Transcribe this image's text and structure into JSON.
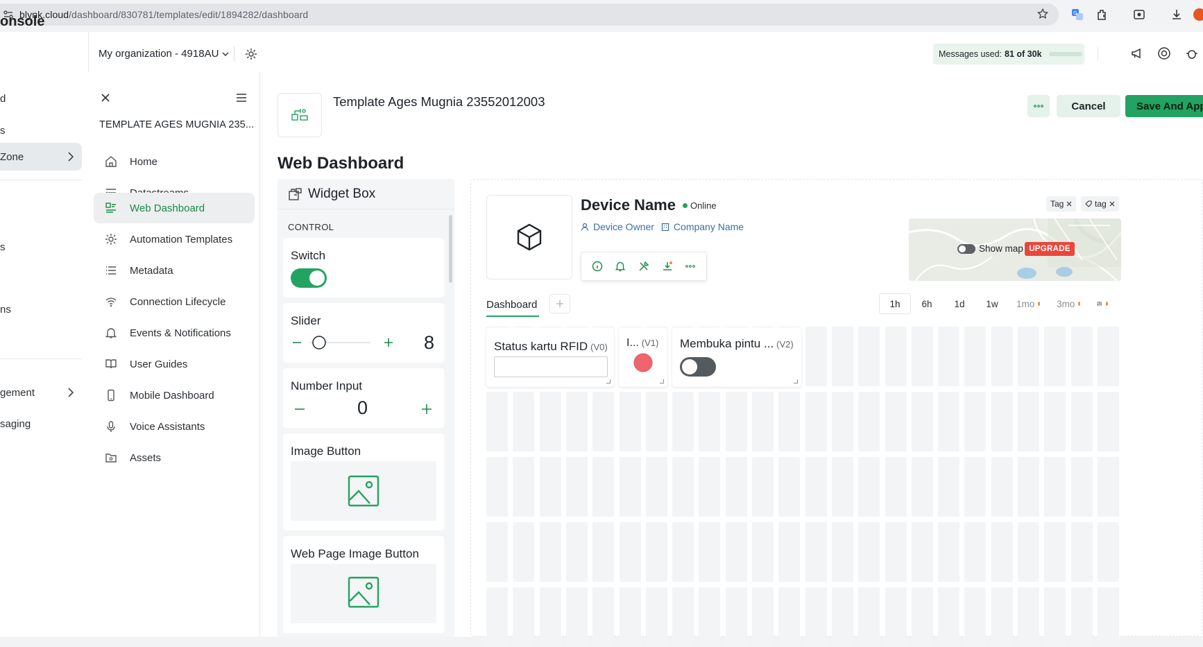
{
  "browser": {
    "url_host": "blynk.cloud",
    "url_path": "/dashboard/830781/templates/edit/1894282/dashboard"
  },
  "topbar": {
    "console_title": "onsole",
    "org_name": "My organization - 4918AU",
    "messages_label": "Messages used:",
    "messages_value": "81 of 30k"
  },
  "main_nav": {
    "items": [
      {
        "label": "d"
      },
      {
        "label": "s"
      },
      {
        "label": "Zone"
      },
      {
        "label": "s"
      },
      {
        "label": "ns"
      },
      {
        "label": "gement"
      },
      {
        "label": "saging"
      }
    ]
  },
  "template_sidebar": {
    "name": "TEMPLATE AGES MUGNIA 235...",
    "items": [
      {
        "label": "Home",
        "icon": "home-icon"
      },
      {
        "label": "Datastreams",
        "icon": "datastreams-icon"
      },
      {
        "label": "Web Dashboard",
        "icon": "web-dashboard-icon"
      },
      {
        "label": "Automation Templates",
        "icon": "automation-icon"
      },
      {
        "label": "Metadata",
        "icon": "metadata-icon"
      },
      {
        "label": "Connection Lifecycle",
        "icon": "wifi-icon"
      },
      {
        "label": "Events & Notifications",
        "icon": "bell-icon"
      },
      {
        "label": "User Guides",
        "icon": "book-icon"
      },
      {
        "label": "Mobile Dashboard",
        "icon": "mobile-icon"
      },
      {
        "label": "Voice Assistants",
        "icon": "microphone-icon"
      },
      {
        "label": "Assets",
        "icon": "folder-icon"
      }
    ]
  },
  "header": {
    "template_title": "Template Ages Mugnia 23552012003",
    "cancel_label": "Cancel",
    "save_label": "Save And Appl",
    "page_title": "Web Dashboard"
  },
  "widget_box": {
    "title": "Widget Box",
    "section": "CONTROL",
    "widgets": {
      "switch": "Switch",
      "slider": "Slider",
      "slider_value": "8",
      "number_input": "Number Input",
      "number_value": "0",
      "image_button": "Image Button",
      "web_image_button": "Web Page Image Button"
    }
  },
  "device": {
    "name": "Device Name",
    "status": "Online",
    "owner": "Device Owner",
    "company": "Company Name",
    "tags": [
      "Tag",
      "tag"
    ],
    "map_label": "Show map",
    "upgrade_label": "UPGRADE"
  },
  "dashboard": {
    "tab_label": "Dashboard",
    "ranges": [
      "1h",
      "6h",
      "1d",
      "1w",
      "1mo",
      "3mo"
    ],
    "active_range": "1h",
    "widgets": [
      {
        "title": "Status kartu RFID",
        "pin": "(V0)"
      },
      {
        "title": "I...",
        "pin": "(V1)"
      },
      {
        "title": "Membuka pintu ...",
        "pin": "(V2)"
      }
    ]
  },
  "colors": {
    "accent": "#23a362",
    "led_red": "#f0656d",
    "upgrade": "#e8473b"
  }
}
